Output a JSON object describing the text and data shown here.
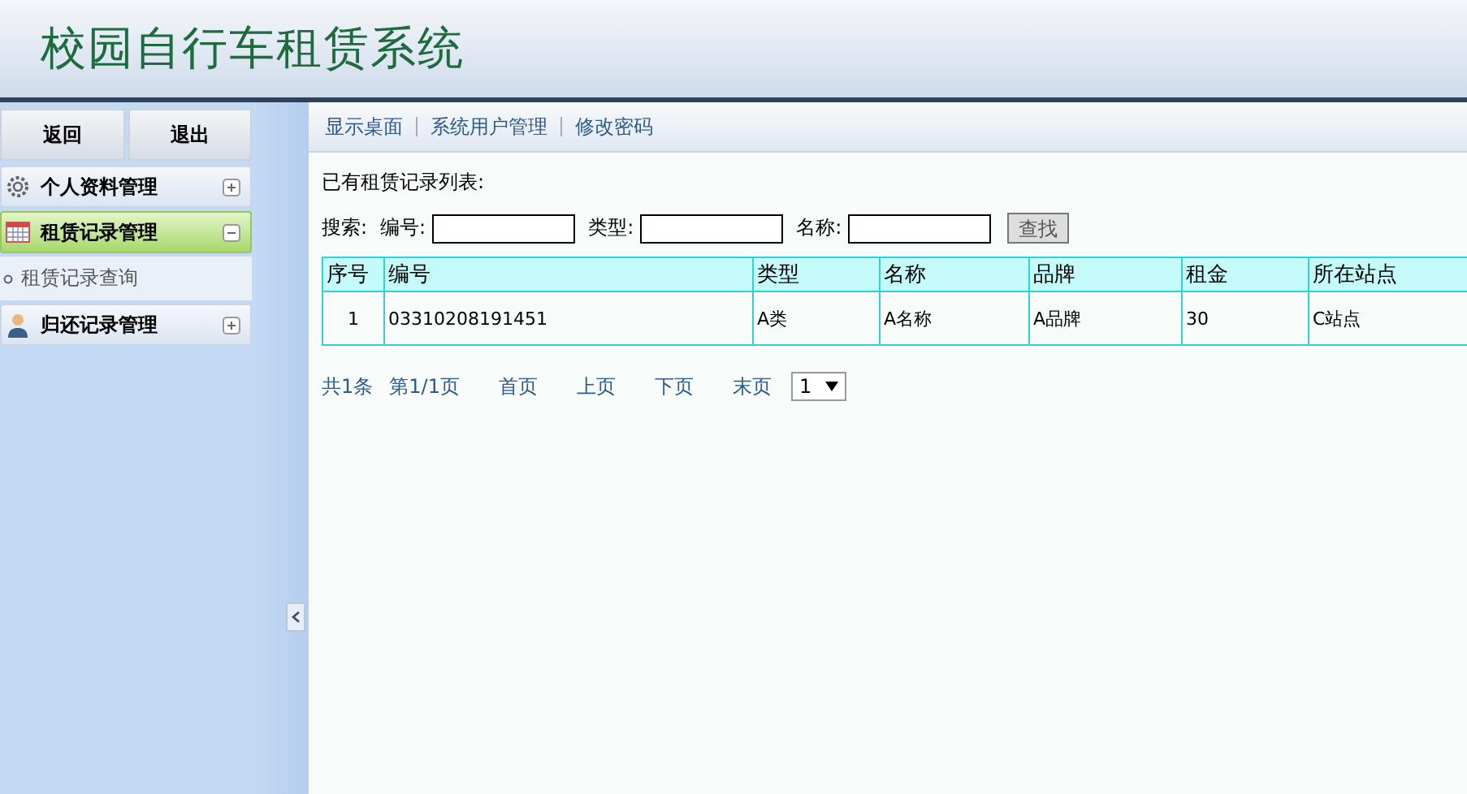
{
  "header": {
    "title": "校园自行车租赁系统"
  },
  "sidebar": {
    "buttons": [
      "返回",
      "退出"
    ],
    "groups": [
      {
        "label": "个人资料管理",
        "expanded": false,
        "selected": false
      },
      {
        "label": "租赁记录管理",
        "expanded": true,
        "selected": true,
        "children": [
          {
            "label": "租赁记录查询"
          }
        ]
      },
      {
        "label": "归还记录管理",
        "expanded": false,
        "selected": false
      }
    ]
  },
  "topnav": [
    "显示桌面",
    "系统用户管理",
    "修改密码"
  ],
  "list_title": "已有租赁记录列表:",
  "search": {
    "label": "搜索:",
    "fields": [
      {
        "label": "编号:"
      },
      {
        "label": "类型:"
      },
      {
        "label": "名称:"
      }
    ],
    "button": "查找"
  },
  "table": {
    "columns": [
      "序号",
      "编号",
      "类型",
      "名称",
      "品牌",
      "租金",
      "所在站点"
    ],
    "rows": [
      [
        "1",
        "03310208191451",
        "A类",
        "A名称",
        "A品牌",
        "30",
        "C站点"
      ]
    ]
  },
  "pager": {
    "total": "共1条",
    "page": "第1/1页",
    "links": [
      "首页",
      "上页",
      "下页",
      "末页"
    ],
    "select": "1"
  }
}
